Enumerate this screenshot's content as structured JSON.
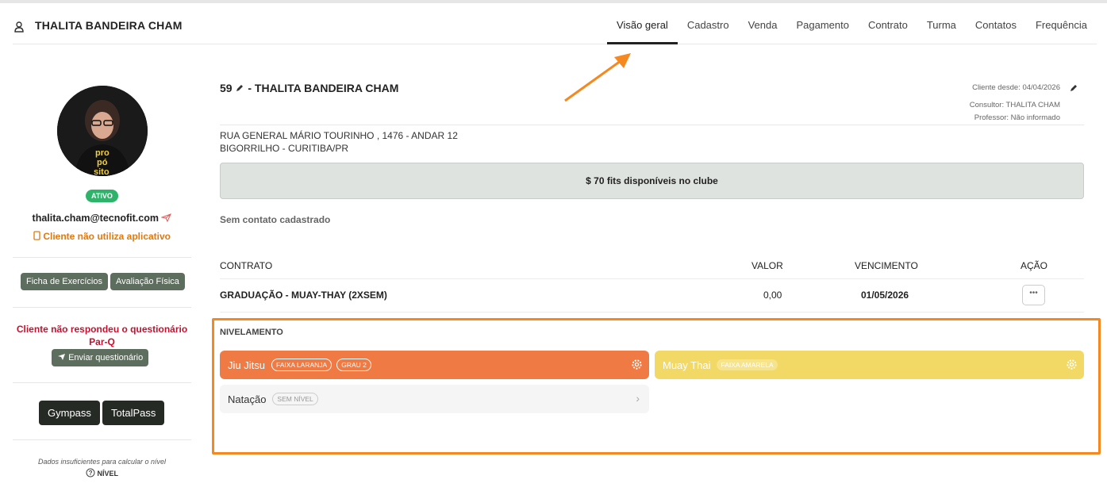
{
  "header": {
    "client_name": "THALITA BANDEIRA CHAM",
    "tabs": [
      "Visão geral",
      "Cadastro",
      "Venda",
      "Pagamento",
      "Contrato",
      "Turma",
      "Contatos",
      "Frequência"
    ],
    "active_tab": "Visão geral"
  },
  "sidebar": {
    "status_badge": "ATIVO",
    "email": "thalita.cham@tecnofit.com",
    "app_status": "Cliente não utiliza aplicativo",
    "buttons": {
      "ficha": "Ficha de Exercícios",
      "avaliacao": "Avaliação Física"
    },
    "parq_warning": "Cliente não respondeu o questionário Par-Q",
    "send_questionnaire": "Enviar questionário",
    "integrations": [
      "Gympass",
      "TotalPass"
    ],
    "nivel_note": "Dados insuficientes para calcular o nível",
    "nivel_label": "NÍVEL"
  },
  "main": {
    "title_number": "59",
    "title_name": "- THALITA BANDEIRA CHAM",
    "client_since": "Cliente desde: 04/04/2026",
    "consultant": "Consultor: THALITA CHAM",
    "professor": "Professor: Não informado",
    "address_line1": "RUA GENERAL MÁRIO TOURINHO , 1476 - ANDAR 12",
    "address_line2": "BIGORRILHO - CURITIBA/PR",
    "fits_text": "$ 70 fits disponíveis no clube",
    "no_contact": "Sem contato cadastrado",
    "table": {
      "headers": {
        "contrato": "CONTRATO",
        "valor": "VALOR",
        "vencimento": "VENCIMENTO",
        "acao": "AÇÃO"
      },
      "rows": [
        {
          "contrato": "GRADUAÇÃO - MUAY-THAY (2XSEM)",
          "valor": "0,00",
          "vencimento": "01/05/2026"
        }
      ]
    }
  },
  "nivelamento": {
    "title": "NIVELAMENTO",
    "cards": [
      {
        "name": "Jiu Jitsu",
        "tags": [
          "FAIXA LARANJA",
          "GRAU 2"
        ],
        "color": "#ef7a43"
      },
      {
        "name": "Muay Thai",
        "tags": [
          "FAIXA AMARELA"
        ],
        "color": "#f2d865"
      },
      {
        "name": "Natação",
        "tags": [
          "SEM NÍVEL"
        ],
        "color": "#f5f5f5"
      }
    ]
  },
  "colors": {
    "highlight": "#f5891f",
    "status_green": "#2fb36b",
    "warning_red": "#c8102e",
    "app_orange": "#e07a10"
  }
}
